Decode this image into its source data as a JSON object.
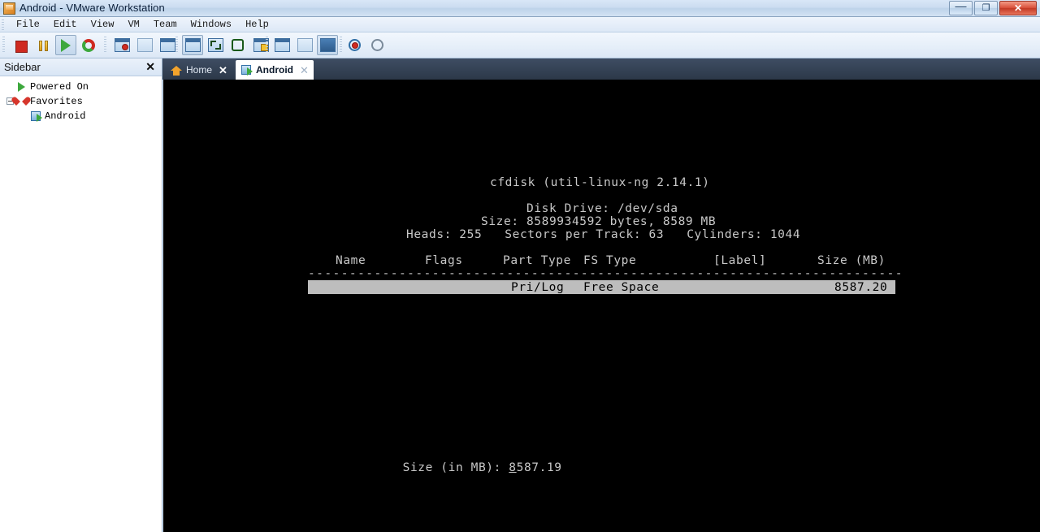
{
  "window": {
    "title": "Android - VMware Workstation",
    "app_icon": "vmware-icon",
    "buttons": {
      "minimize": "—",
      "restore": "❐",
      "close": "✕"
    }
  },
  "menubar": {
    "items": [
      "File",
      "Edit",
      "View",
      "VM",
      "Team",
      "Windows",
      "Help"
    ]
  },
  "toolbar": {
    "groups": [
      {
        "name": "power-controls",
        "buttons": [
          {
            "name": "power-off-button",
            "icon": "stop-icon",
            "pressed": false
          },
          {
            "name": "suspend-button",
            "icon": "pause-icon",
            "pressed": false
          },
          {
            "name": "power-on-button",
            "icon": "play-icon",
            "pressed": true
          },
          {
            "name": "reset-button",
            "icon": "reset-icon",
            "pressed": false
          }
        ]
      },
      {
        "name": "snapshot-controls",
        "buttons": [
          {
            "name": "take-snapshot-button",
            "icon": "snapshot-add-icon",
            "pressed": false
          },
          {
            "name": "revert-snapshot-button",
            "icon": "snapshot-revert-icon",
            "pressed": false
          },
          {
            "name": "snapshot-manager-button",
            "icon": "snapshot-manager-icon",
            "pressed": false
          }
        ]
      },
      {
        "name": "view-controls",
        "buttons": [
          {
            "name": "console-view-button",
            "icon": "console-icon",
            "pressed": true
          },
          {
            "name": "fit-guest-button",
            "icon": "fit-guest-icon",
            "pressed": false
          },
          {
            "name": "fullscreen-button",
            "icon": "fullscreen-icon",
            "pressed": false
          },
          {
            "name": "unity-button",
            "icon": "unity-icon",
            "pressed": false
          }
        ]
      },
      {
        "name": "settings-controls",
        "buttons": [
          {
            "name": "vm-settings-button",
            "icon": "wrench-icon",
            "pressed": false
          },
          {
            "name": "summary-view-button",
            "icon": "summary-icon",
            "pressed": false
          },
          {
            "name": "multiple-windows-button",
            "icon": "windows-icon",
            "pressed": true
          }
        ]
      },
      {
        "name": "sidebar-controls",
        "buttons": [
          {
            "name": "show-sidebar-button",
            "icon": "sidebar-left-icon",
            "pressed": false
          },
          {
            "name": "show-thumbnails-button",
            "icon": "thumbnail-bar-icon",
            "pressed": false
          }
        ]
      }
    ]
  },
  "sidebar": {
    "title": "Sidebar",
    "close_label": "✕",
    "items": [
      {
        "label": "Powered On",
        "icon": "green-play-icon",
        "indent": 1,
        "expander": false
      },
      {
        "label": "Favorites",
        "icon": "red-heart-icon",
        "indent": 1,
        "expander": true
      },
      {
        "label": "Android",
        "icon": "vm-icon",
        "indent": 2,
        "expander": false
      }
    ]
  },
  "tabs": [
    {
      "label": "Home",
      "icon": "home-icon",
      "active": false,
      "close_label": "✕"
    },
    {
      "label": "Android",
      "icon": "vm-icon",
      "active": true,
      "close_label": "✕"
    }
  ],
  "terminal": {
    "program_title": "cfdisk (util-linux-ng 2.14.1)",
    "disk_drive_line": "Disk Drive: /dev/sda",
    "size_line": "Size: 8589934592 bytes, 8589 MB",
    "geometry_line": "Heads: 255   Sectors per Track: 63   Cylinders: 1044",
    "columns": {
      "name": "Name",
      "flags": "Flags",
      "part_type": "Part Type",
      "fs_type": "FS Type",
      "label": "[Label]",
      "size": "Size (MB)"
    },
    "separator": "------------------------------------------------------------------------",
    "rows": [
      {
        "name": "",
        "flags": "",
        "part_type": "Pri/Log",
        "fs_type": "Free Space",
        "label": "",
        "size": "8587.20",
        "selected": true
      }
    ],
    "prompt": {
      "label": "Size (in MB):",
      "value_cursor_char": "8",
      "value_rest": "587.19"
    }
  },
  "colors": {
    "terminal_bg": "#000000",
    "terminal_fg": "#c8c8c8",
    "selection_bg": "#bdbdbd",
    "selection_fg": "#000000",
    "titlebar_accent": "#bed3ea",
    "close_button": "#c23a25",
    "tabstrip_bg": "#2c3848"
  }
}
